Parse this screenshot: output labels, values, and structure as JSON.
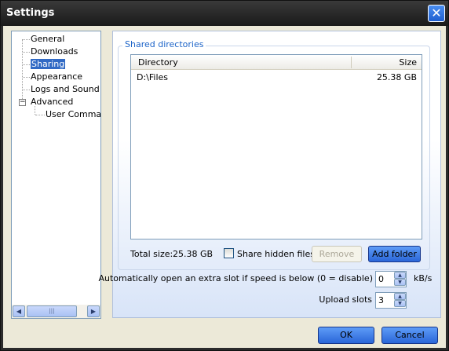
{
  "window": {
    "title": "Settings"
  },
  "tree": {
    "items": [
      {
        "label": "General"
      },
      {
        "label": "Downloads"
      },
      {
        "label": "Sharing",
        "selected": true
      },
      {
        "label": "Appearance"
      },
      {
        "label": "Logs and Sound"
      },
      {
        "label": "Advanced",
        "expanded": true
      },
      {
        "label": "User Commands"
      }
    ]
  },
  "sharing": {
    "group_title": "Shared directories",
    "columns": [
      "Directory",
      "Size"
    ],
    "rows": [
      {
        "directory": "D:\\Files",
        "size": "25.38 GB"
      }
    ],
    "total_label": "Total size:",
    "total_value": "25.38 GB",
    "share_hidden_label": "Share hidden files",
    "share_hidden_checked": false,
    "remove_label": "Remove",
    "add_folder_label": "Add folder",
    "extra_slot_label": "Automatically open an extra slot if speed is below (0 = disable)",
    "extra_slot_value": "0",
    "extra_slot_unit": "kB/s",
    "upload_slots_label": "Upload slots",
    "upload_slots_value": "3"
  },
  "footer": {
    "ok_label": "OK",
    "cancel_label": "Cancel"
  }
}
